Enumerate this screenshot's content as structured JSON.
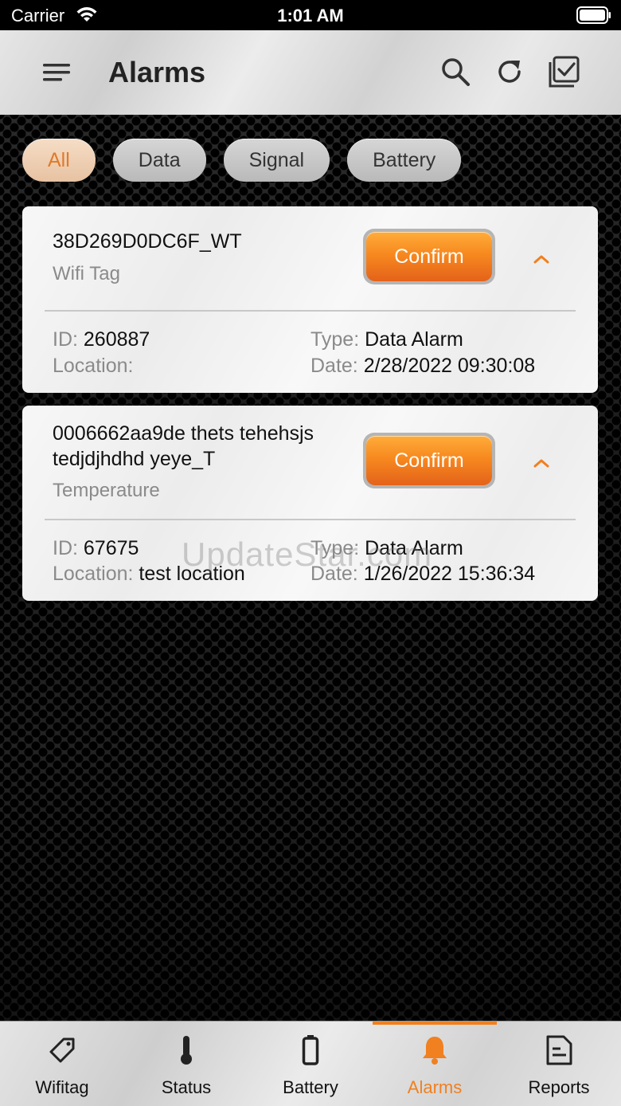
{
  "status_bar": {
    "carrier": "Carrier",
    "time": "1:01 AM"
  },
  "header": {
    "title": "Alarms"
  },
  "filters": [
    {
      "label": "All",
      "active": true
    },
    {
      "label": "Data",
      "active": false
    },
    {
      "label": "Signal",
      "active": false
    },
    {
      "label": "Battery",
      "active": false
    }
  ],
  "alarms": [
    {
      "name": "38D269D0DC6F_WT",
      "subtitle": "Wifi Tag",
      "confirm_label": "Confirm",
      "id_label": "ID:",
      "id_value": "260887",
      "location_label": "Location:",
      "location_value": "",
      "type_label": "Type:",
      "type_value": "Data Alarm",
      "date_label": "Date:",
      "date_value": "2/28/2022 09:30:08"
    },
    {
      "name": "0006662aa9de thets tehehsjs tedjdjhdhd yeye_T",
      "subtitle": "Temperature",
      "confirm_label": "Confirm",
      "id_label": "ID:",
      "id_value": "67675",
      "location_label": "Location:",
      "location_value": "test location",
      "type_label": "Type:",
      "type_value": "Data Alarm",
      "date_label": "Date:",
      "date_value": "1/26/2022 15:36:34"
    }
  ],
  "watermark": "UpdateStar.com",
  "tabs": [
    {
      "label": "Wifitag",
      "icon": "tag-icon",
      "active": false
    },
    {
      "label": "Status",
      "icon": "thermometer-icon",
      "active": false
    },
    {
      "label": "Battery",
      "icon": "battery-icon",
      "active": false
    },
    {
      "label": "Alarms",
      "icon": "bell-icon",
      "active": true
    },
    {
      "label": "Reports",
      "icon": "report-icon",
      "active": false
    }
  ],
  "colors": {
    "accent": "#f08020",
    "confirm_top": "#ffad3b",
    "confirm_bottom": "#e4621a"
  }
}
